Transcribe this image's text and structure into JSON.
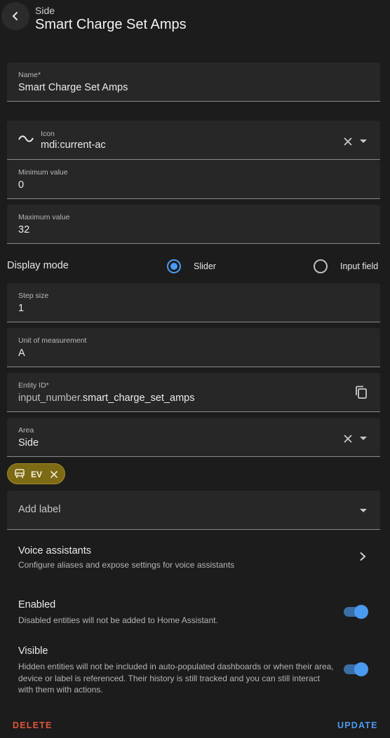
{
  "header": {
    "subtitle": "Side",
    "title": "Smart Charge Set Amps"
  },
  "name_field": {
    "label": "Name*",
    "value": "Smart Charge Set Amps"
  },
  "icon_field": {
    "label": "Icon",
    "value": "mdi:current-ac",
    "icon": "current-ac-icon"
  },
  "min_field": {
    "label": "Minimum value",
    "value": "0"
  },
  "max_field": {
    "label": "Maximum value",
    "value": "32"
  },
  "display_mode": {
    "label": "Display mode",
    "options": [
      {
        "label": "Slider",
        "selected": true
      },
      {
        "label": "Input field",
        "selected": false
      }
    ]
  },
  "step_field": {
    "label": "Step size",
    "value": "1"
  },
  "unit_field": {
    "label": "Unit of measurement",
    "value": "A"
  },
  "entity_field": {
    "label": "Entity ID*",
    "prefix": "input_number.",
    "value": "smart_charge_set_amps"
  },
  "area_field": {
    "label": "Area",
    "value": "Side"
  },
  "label_chip": {
    "text": "EV",
    "icon": "car-icon",
    "color": "#7d6a15"
  },
  "add_label": {
    "placeholder": "Add label"
  },
  "voice": {
    "title": "Voice assistants",
    "description": "Configure aliases and expose settings for voice assistants"
  },
  "enabled": {
    "title": "Enabled",
    "description": "Disabled entities will not be added to Home Assistant.",
    "on": true
  },
  "visible": {
    "title": "Visible",
    "description": "Hidden entities will not be included in auto-populated dashboards or when their area, device or label is referenced. Their history is still tracked and you can still interact with them with actions.",
    "on": true
  },
  "actions": {
    "delete": "DELETE",
    "update": "UPDATE"
  },
  "colors": {
    "accent": "#4a9af0",
    "danger": "#e0553a",
    "background": "#1c1c1c",
    "field": "#272727"
  }
}
